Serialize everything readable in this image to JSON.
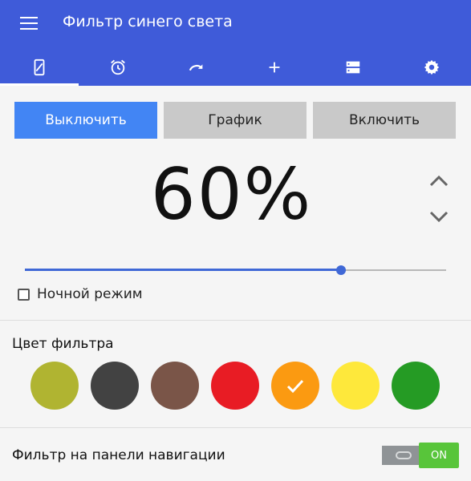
{
  "app_bar": {
    "title": "Фильтр синего света",
    "menu_icon": "hamburger-menu-icon",
    "background": "#3f5bd9"
  },
  "tabs": [
    {
      "name": "filter",
      "icon": "phone-filter-icon",
      "active": true
    },
    {
      "name": "alarm",
      "icon": "alarm-clock-icon",
      "active": false
    },
    {
      "name": "redo",
      "icon": "redo-arrow-icon",
      "active": false
    },
    {
      "name": "add",
      "icon": "plus-icon",
      "active": false
    },
    {
      "name": "storage",
      "icon": "storage-icon",
      "active": false
    },
    {
      "name": "settings",
      "icon": "gear-icon",
      "active": false
    }
  ],
  "modes": {
    "off_label": "Выключить",
    "schedule_label": "График",
    "on_label": "Включить",
    "active": "off",
    "active_color": "#4285f4"
  },
  "opacity": {
    "display": "60%",
    "slider_fraction": 0.75,
    "up_icon": "chevron-up-icon",
    "down_icon": "chevron-down-icon"
  },
  "night_mode": {
    "label": "Ночной режим",
    "checked": false
  },
  "filter_color": {
    "title": "Цвет фильтра",
    "swatches": [
      {
        "name": "olive",
        "color": "#b0b431",
        "selected": false
      },
      {
        "name": "dark-gray",
        "color": "#424242",
        "selected": false
      },
      {
        "name": "brown",
        "color": "#7a5548",
        "selected": false
      },
      {
        "name": "red",
        "color": "#e81c24",
        "selected": false
      },
      {
        "name": "orange",
        "color": "#fb9a11",
        "selected": true
      },
      {
        "name": "yellow",
        "color": "#fee83b",
        "selected": false
      },
      {
        "name": "green",
        "color": "#259b24",
        "selected": false
      }
    ]
  },
  "nav_bar_filter": {
    "label": "Фильтр на панели навигации",
    "toggle_text": "ON",
    "enabled": true
  }
}
